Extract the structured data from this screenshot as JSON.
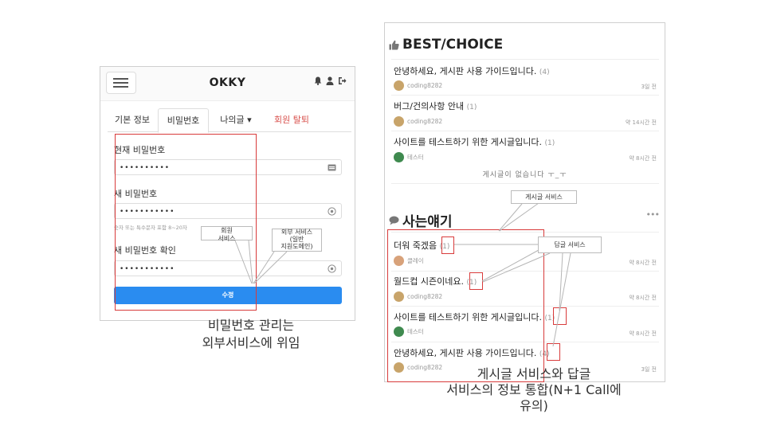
{
  "left_screen": {
    "app_title": "OKKY",
    "tabs": [
      "기본 정보",
      "비밀번호",
      "나의글 ▾",
      "회원 탈퇴"
    ],
    "active_tab": "비밀번호",
    "fields": [
      {
        "label": "현재 비밀번호",
        "value": "••••••••••",
        "icon": "key-icon"
      },
      {
        "label": "새 비밀번호",
        "value": "•••••••••••",
        "icon": "eye-icon"
      },
      {
        "label": "새 비밀번호 확인",
        "value": "•••••••••••",
        "icon": "eye-icon"
      }
    ],
    "password_hint": "숫자 또는 특수문자 포함 8~20자",
    "submit_label": "수정"
  },
  "right_screen": {
    "best_title": "BEST/CHOICE",
    "best_items": [
      {
        "title": "안녕하세요, 게시판 사용 가이드입니다.",
        "count": "(4)",
        "author": "coding8282",
        "time": "3일 전"
      },
      {
        "title": "버그/건의사항 안내",
        "count": "(1)",
        "author": "coding8282",
        "time": "약 14시간 전"
      },
      {
        "title": "사이트를 테스트하기 위한 게시글입니다.",
        "count": "(1)",
        "author": "테스터",
        "time": "약 8시간 전"
      }
    ],
    "empty_message": "게시글이 없습니다 ㅜ_ㅜ",
    "life_title": "사는얘기",
    "life_items": [
      {
        "title": "더워 죽겠음",
        "count": "(1)",
        "author": "클레이",
        "time": "약 8시간 전"
      },
      {
        "title": "월드컵 시즌이네요.",
        "count": "(1)",
        "author": "coding8282",
        "time": "약 8시간 전"
      },
      {
        "title": "사이트를 테스트하기 위한 게시글입니다.",
        "count": "(1)",
        "author": "테스터",
        "time": "약 8시간 전"
      },
      {
        "title": "안녕하세요, 게시판 사용 가이드입니다.",
        "count": "(4)",
        "author": "coding8282",
        "time": "3일 전"
      }
    ]
  },
  "annotations": {
    "member_service": "회원\n서비스",
    "external_service": "외부 서비스\n(일반\n지원도메인)",
    "left_caption": "비밀번호 관리는\n외부서비스에 위임",
    "post_service": "게시글 서비스",
    "reply_service": "답글 서비스",
    "right_caption": "게시글 서비스와 답글\n서비스의 정보 통합(N+1 Call에\n유의)"
  },
  "colors": {
    "accent": "#2a8cf0",
    "danger": "#d9534f",
    "annotation_red": "#d83b3b"
  }
}
